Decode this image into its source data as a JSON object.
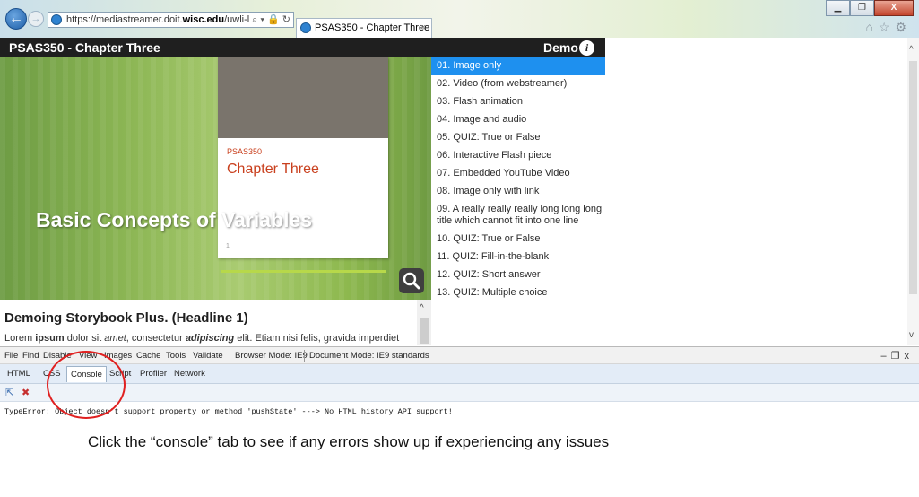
{
  "browser": {
    "url_prefix": "https://mediastreamer.doit.",
    "url_domain": "wisc.edu",
    "url_suffix": "/uwli-ltc/sandl",
    "address_tools": "⌕ ▾ 🔒 ↻",
    "tab_title": "PSAS350 - Chapter Three",
    "tab_close": "×",
    "back_glyph": "←",
    "forward_glyph": "→",
    "window_controls": [
      "▁",
      "❐",
      "X"
    ],
    "toolbar_icons": "⌂☆⚙"
  },
  "player": {
    "title": "PSAS350 - Chapter Three",
    "demo_label": "Demo",
    "info_glyph": "i",
    "slide": {
      "course": "PSAS350",
      "chapter": "Chapter Three",
      "heading": "Basic Concepts of Variables",
      "page_number": "1"
    },
    "content": {
      "headline": "Demoing Storybook Plus. (Headline 1)",
      "lorem_1": "Lorem ",
      "lorem_bold": "ipsum",
      "lorem_2": " dolor sit ",
      "lorem_italic": "amet",
      "lorem_3": ", consectetur ",
      "lorem_bold_italic": "adipiscing",
      "lorem_4": " elit. Etiam nisi felis, gravida imperdiet"
    },
    "menu": [
      {
        "label": "01. Image only",
        "active": true
      },
      {
        "label": "02. Video (from webstreamer)",
        "active": false
      },
      {
        "label": "03. Flash animation",
        "active": false
      },
      {
        "label": "04. Image and audio",
        "active": false
      },
      {
        "label": "05. QUIZ: True or False",
        "active": false
      },
      {
        "label": "06. Interactive Flash piece",
        "active": false
      },
      {
        "label": "07. Embedded YouTube Video",
        "active": false
      },
      {
        "label": "08. Image only with link",
        "active": false
      },
      {
        "label": "09. A really really really long long long title which cannot fit into one line",
        "active": false
      },
      {
        "label": "10. QUIZ: True or False",
        "active": false
      },
      {
        "label": "11. QUIZ: Fill-in-the-blank",
        "active": false
      },
      {
        "label": "12. QUIZ: Short answer",
        "active": false
      },
      {
        "label": "13. QUIZ: Multiple choice",
        "active": false
      }
    ]
  },
  "scroll_glyphs": {
    "up": "^",
    "down": "v"
  },
  "devtools": {
    "menu": [
      "File",
      "Find",
      "Disable",
      "View",
      "Images",
      "Cache",
      "Tools",
      "Validate"
    ],
    "browser_mode": "Browser Mode: IE9",
    "document_mode": "Document Mode: IE9 standards",
    "window_buttons": "–❐x",
    "tabs": [
      "HTML",
      "CSS",
      "Console",
      "Script",
      "Profiler",
      "Network"
    ],
    "active_tab": "Console",
    "tool_select_glyph": "⇱",
    "tool_clear_glyph": "✖",
    "error_message": "TypeError: Object doesn't support property or method 'pushState' ---> No HTML history API support!"
  },
  "annotation": {
    "callout": "Click the “console” tab to see if any errors show up if experiencing any issues"
  },
  "colors": {
    "menu_active": "#1e90ef",
    "header_bg": "#1f1f1f",
    "slide_accent": "#c9401e",
    "annotation_circle": "#e02020"
  }
}
